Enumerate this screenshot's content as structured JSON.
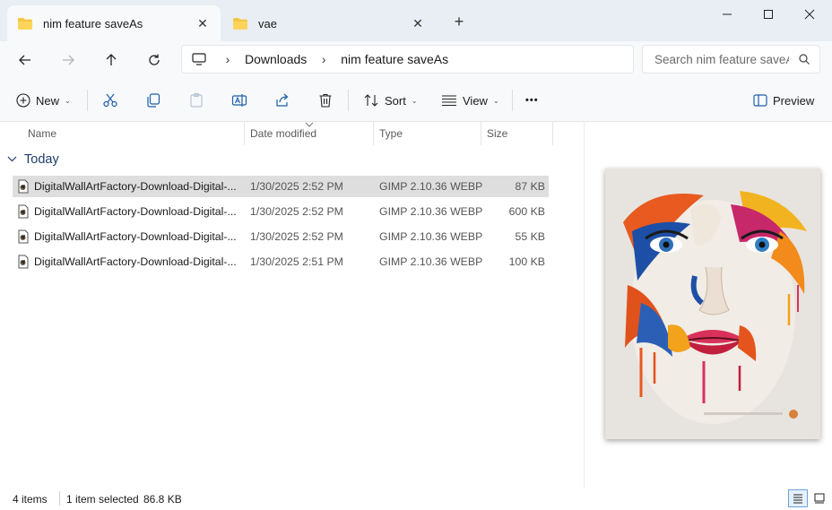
{
  "tabs": [
    {
      "label": "nim feature saveAs",
      "active": true
    },
    {
      "label": "vae",
      "active": false
    }
  ],
  "tab_close_glyph": "✕",
  "new_tab_glyph": "+",
  "window_controls": [
    "minimize-icon",
    "maximize-icon",
    "close-icon"
  ],
  "breadcrumb": [
    "Downloads",
    "nim feature saveAs"
  ],
  "crumb_sep": "›",
  "search": {
    "placeholder": "Search nim feature saveAs"
  },
  "toolbar": {
    "new_label": "New",
    "sort_label": "Sort",
    "view_label": "View",
    "more_label": "•••",
    "preview_label": "Preview",
    "caret": "⌄"
  },
  "columns": [
    "Name",
    "Date modified",
    "Type",
    "Size"
  ],
  "group": {
    "label": "Today",
    "chevron": "⌄"
  },
  "files": [
    {
      "name": "DigitalWallArtFactory-Download-Digital-...",
      "date": "1/30/2025 2:52 PM",
      "type": "GIMP 2.10.36 WEBP",
      "size": "87 KB",
      "selected": true
    },
    {
      "name": "DigitalWallArtFactory-Download-Digital-...",
      "date": "1/30/2025 2:52 PM",
      "type": "GIMP 2.10.36 WEBP",
      "size": "600 KB",
      "selected": false
    },
    {
      "name": "DigitalWallArtFactory-Download-Digital-...",
      "date": "1/30/2025 2:52 PM",
      "type": "GIMP 2.10.36 WEBP",
      "size": "55 KB",
      "selected": false
    },
    {
      "name": "DigitalWallArtFactory-Download-Digital-...",
      "date": "1/30/2025 2:51 PM",
      "type": "GIMP 2.10.36 WEBP",
      "size": "100 KB",
      "selected": false
    }
  ],
  "status": {
    "count": "4 items",
    "selected": "1 item selected",
    "size": "86.8 KB"
  },
  "colors": {
    "accent": "#0067c0",
    "selection": "#dedede",
    "group": "#1f3c6a",
    "folder": "#f5c542"
  }
}
